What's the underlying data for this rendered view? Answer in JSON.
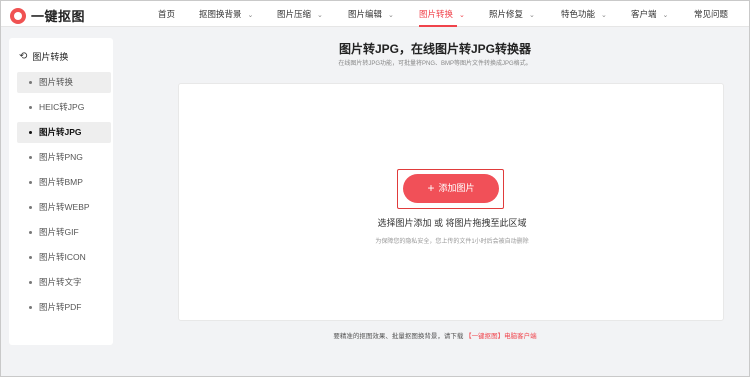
{
  "app": {
    "logo_text": "一键抠图"
  },
  "nav": [
    {
      "label": "首页",
      "dropdown": false
    },
    {
      "label": "抠图换背景",
      "dropdown": true
    },
    {
      "label": "图片压缩",
      "dropdown": true
    },
    {
      "label": "图片编辑",
      "dropdown": true
    },
    {
      "label": "图片转换",
      "dropdown": true,
      "active": true
    },
    {
      "label": "照片修复",
      "dropdown": true
    },
    {
      "label": "特色功能",
      "dropdown": true
    },
    {
      "label": "客户端",
      "dropdown": true
    },
    {
      "label": "常见问题",
      "dropdown": false
    }
  ],
  "sidebar": {
    "heading": "图片转换",
    "items": [
      {
        "label": "图片转换"
      },
      {
        "label": "HEIC转JPG"
      },
      {
        "label": "图片转JPG"
      },
      {
        "label": "图片转PNG"
      },
      {
        "label": "图片转BMP"
      },
      {
        "label": "图片转WEBP"
      },
      {
        "label": "图片转GIF"
      },
      {
        "label": "图片转ICON"
      },
      {
        "label": "图片转文字"
      },
      {
        "label": "图片转PDF"
      }
    ]
  },
  "main": {
    "title": "图片转JPG，在线图片转JPG转换器",
    "subtitle": "在线图片转JPG功能，可批量将PNG、BMP等图片文件转换成JPG格式。",
    "add_button": "添加图片",
    "drop_text": "选择图片添加 或 将图片拖拽至此区域",
    "privacy_text": "为保障您的隐私安全，您上传的文件1小时后会被自动删除",
    "footer_prefix": "要精准的抠图效果、批量抠图换背景，请下载",
    "footer_link": "【一键抠图】电脑客户端"
  },
  "colors": {
    "accent": "#f0434b",
    "button": "#f15058"
  }
}
